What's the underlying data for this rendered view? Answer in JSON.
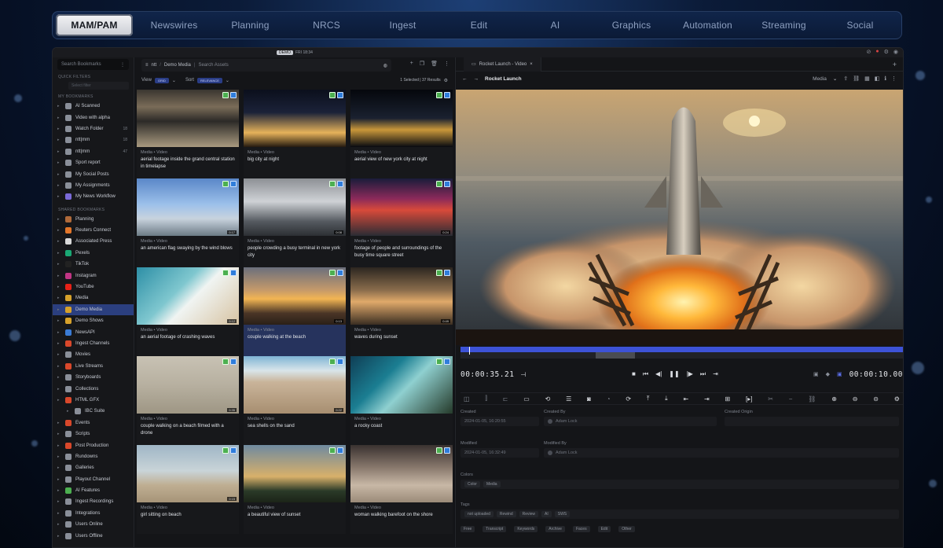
{
  "topnav": {
    "tabs": [
      "MAM/PAM",
      "Newswires",
      "Planning",
      "NRCS",
      "Ingest",
      "Edit",
      "AI",
      "Graphics",
      "Automation",
      "Streaming",
      "Social"
    ],
    "active": "MAM/PAM"
  },
  "statusbar": {
    "live_label": "DEMO",
    "clock": "FRI 18:34"
  },
  "sidebar": {
    "search_placeholder": "Search Bookmarks",
    "quick_filters_label": "QUICK FILTERS",
    "filter_placeholder": "Select filter",
    "my_bookmarks_label": "MY BOOKMARKS",
    "my_bookmarks": [
      {
        "label": "AI Scanned",
        "color": "#8a8f99",
        "count": ""
      },
      {
        "label": "Video with alpha",
        "color": "#8a8f99",
        "count": ""
      },
      {
        "label": "Watch Folder",
        "color": "#8a8f99",
        "count": "18"
      },
      {
        "label": "ntt|mm",
        "color": "#8a8f99",
        "count": "18"
      },
      {
        "label": "ntt|mm",
        "color": "#8a8f99",
        "count": "47"
      },
      {
        "label": "Sport report",
        "color": "#8a8f99",
        "count": ""
      },
      {
        "label": "My Social Posts",
        "color": "#8a8f99",
        "count": ""
      },
      {
        "label": "My Assignments",
        "color": "#8a8f99",
        "count": ""
      },
      {
        "label": "My News Workflow",
        "color": "#7a6ad8",
        "count": ""
      }
    ],
    "shared_bookmarks_label": "SHARED BOOKMARKS",
    "shared_bookmarks": [
      {
        "label": "Planning",
        "color": "#b06a3a"
      },
      {
        "label": "Reuters Connect",
        "color": "#e2762a"
      },
      {
        "label": "Associated Press",
        "color": "#d9d9d9"
      },
      {
        "label": "Pexels",
        "color": "#1aa874"
      },
      {
        "label": "TikTok",
        "color": "#222222"
      },
      {
        "label": "Instagram",
        "color": "#c13584"
      },
      {
        "label": "YouTube",
        "color": "#e62117"
      },
      {
        "label": "Media",
        "color": "#d6a12b"
      },
      {
        "label": "Demo Media",
        "color": "#d6a12b"
      },
      {
        "label": "Demo Shows",
        "color": "#d6a12b"
      },
      {
        "label": "NewsAPI",
        "color": "#3a7bd5"
      },
      {
        "label": "Ingest Channels",
        "color": "#d9482b"
      },
      {
        "label": "Movies",
        "color": "#8a8f99"
      },
      {
        "label": "Live Streams",
        "color": "#d9482b"
      },
      {
        "label": "Storyboards",
        "color": "#8a8f99"
      },
      {
        "label": "Collections",
        "color": "#8a8f99"
      },
      {
        "label": "HTML GFX",
        "color": "#d9482b"
      },
      {
        "label": "IBC Suite",
        "color": "#8a8f99"
      },
      {
        "label": "Events",
        "color": "#d9482b"
      },
      {
        "label": "Scripts",
        "color": "#8a8f99"
      },
      {
        "label": "Post Production",
        "color": "#d9482b"
      },
      {
        "label": "Rundowns",
        "color": "#8a8f99"
      },
      {
        "label": "Galleries",
        "color": "#8a8f99"
      },
      {
        "label": "Playout Channel",
        "color": "#8a8f99"
      },
      {
        "label": "AI Features",
        "color": "#4caf50"
      },
      {
        "label": "Ingest Recordings",
        "color": "#8a8f99"
      },
      {
        "label": "Integrations",
        "color": "#8a8f99"
      },
      {
        "label": "Users Online",
        "color": "#8a8f99"
      },
      {
        "label": "Users Offline",
        "color": "#8a8f99"
      }
    ],
    "active_item": "Demo Media"
  },
  "gallery": {
    "path": {
      "root": "ntt",
      "folder": "Demo Media",
      "search_placeholder": "Search Assets"
    },
    "view_label": "View",
    "view_value": "GRID",
    "sort_label": "Sort",
    "sort_value": "RELEVANCE",
    "selection_summary": "1 Selected | 37 Results",
    "items": [
      {
        "type": "Media • Video",
        "title": "aerial footage inside the grand central station in timelapse",
        "duration": "",
        "scene": "station"
      },
      {
        "type": "Media • Video",
        "title": "big city at night",
        "duration": "",
        "scene": "citynight"
      },
      {
        "type": "Media • Video",
        "title": "aerial view of new york city at night",
        "duration": "",
        "scene": "nycnight"
      },
      {
        "type": "Media • Video",
        "title": "an american flag swaying by the wind blows",
        "duration": "0:17",
        "scene": "flag"
      },
      {
        "type": "Media • Video",
        "title": "people crowding a busy terminal in new york city",
        "duration": "0:08",
        "scene": "terminal"
      },
      {
        "type": "Media • Video",
        "title": "footage of people and surroundings of the busy time square street",
        "duration": "0:24",
        "scene": "timessquare"
      },
      {
        "type": "Media • Video",
        "title": "an aerial footage of crashing waves",
        "duration": "0:12",
        "scene": "waves"
      },
      {
        "type": "Media • Video",
        "title": "couple walking at the beach",
        "duration": "0:13",
        "scene": "sunsetbeach"
      },
      {
        "type": "Media • Video",
        "title": "waves during sunset",
        "duration": "0:49",
        "scene": "wavesunset"
      },
      {
        "type": "Media • Video",
        "title": "couple walking on a beach filmed with a drone",
        "duration": "0:35",
        "scene": "dronebeach"
      },
      {
        "type": "Media • Video",
        "title": "sea shells on the sand",
        "duration": "0:22",
        "scene": "shells"
      },
      {
        "type": "Media • Video",
        "title": "a rocky coast",
        "duration": "",
        "scene": "coast"
      },
      {
        "type": "Media • Video",
        "title": "girl sitting on beach",
        "duration": "0:15",
        "scene": "girl"
      },
      {
        "type": "Media • Video",
        "title": "a beautiful view of sunset",
        "duration": "",
        "scene": "palm"
      },
      {
        "type": "Media • Video",
        "title": "woman walking barefoot on the shore",
        "duration": "",
        "scene": "barefoot"
      }
    ],
    "selected_index": 7
  },
  "player": {
    "tab_title": "Rocket Launch - Video",
    "header_title": "Rocket Launch",
    "media_dropdown": "Media",
    "timecode_current": "00:00:35.21",
    "timecode_duration": "00:00:10.00",
    "progress": 0.02,
    "metadata": {
      "created_label": "Created",
      "created_value": "2024-01-05, 16:20:55",
      "created_by_label": "Created By",
      "created_by_value": "Adam Lock",
      "created_origin_label": "Created Origin",
      "modified_label": "Modified",
      "modified_value": "2024-01-05, 16:32:49",
      "modified_by_label": "Modified By",
      "modified_by_value": "Adam Lock",
      "colors_label": "Colors",
      "colors_chips": [
        "Color",
        "Media"
      ],
      "tags_label": "Tags",
      "tags_chips": [
        "not uploaded",
        "Rewind",
        "Review",
        "AI",
        "SWS"
      ],
      "footer_chips": [
        "Free",
        "Transcript",
        "Keywords",
        "Archive",
        "Faces",
        "Edit",
        "Other"
      ]
    }
  }
}
